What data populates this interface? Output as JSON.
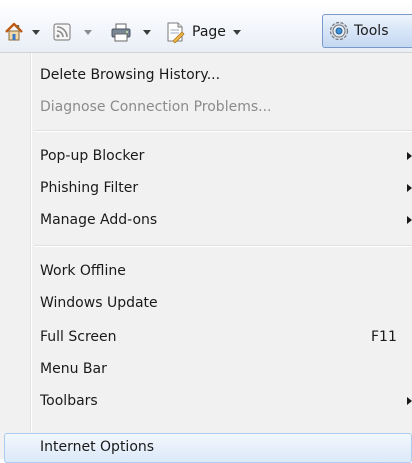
{
  "toolbar": {
    "home_icon": "home-icon",
    "feeds_icon": "feeds-icon",
    "print_icon": "printer-icon",
    "page_icon": "page-icon",
    "page_label": "Page",
    "tools_icon": "gear-icon",
    "tools_label": "Tools"
  },
  "menu": {
    "groups": [
      [
        {
          "label": "Delete Browsing History...",
          "disabled": false
        },
        {
          "label": "Diagnose Connection Problems...",
          "disabled": true
        }
      ],
      [
        {
          "label": "Pop-up Blocker",
          "submenu": true
        },
        {
          "label": "Phishing Filter",
          "submenu": true
        },
        {
          "label": "Manage Add-ons",
          "submenu": true
        }
      ],
      [
        {
          "label": "Work Offline"
        },
        {
          "label": "Windows Update"
        },
        {
          "label": "Full Screen",
          "shortcut": "F11"
        },
        {
          "label": "Menu Bar"
        },
        {
          "label": "Toolbars",
          "submenu": true
        }
      ],
      [
        {
          "label": "Internet Options",
          "highlighted": true
        }
      ]
    ]
  }
}
